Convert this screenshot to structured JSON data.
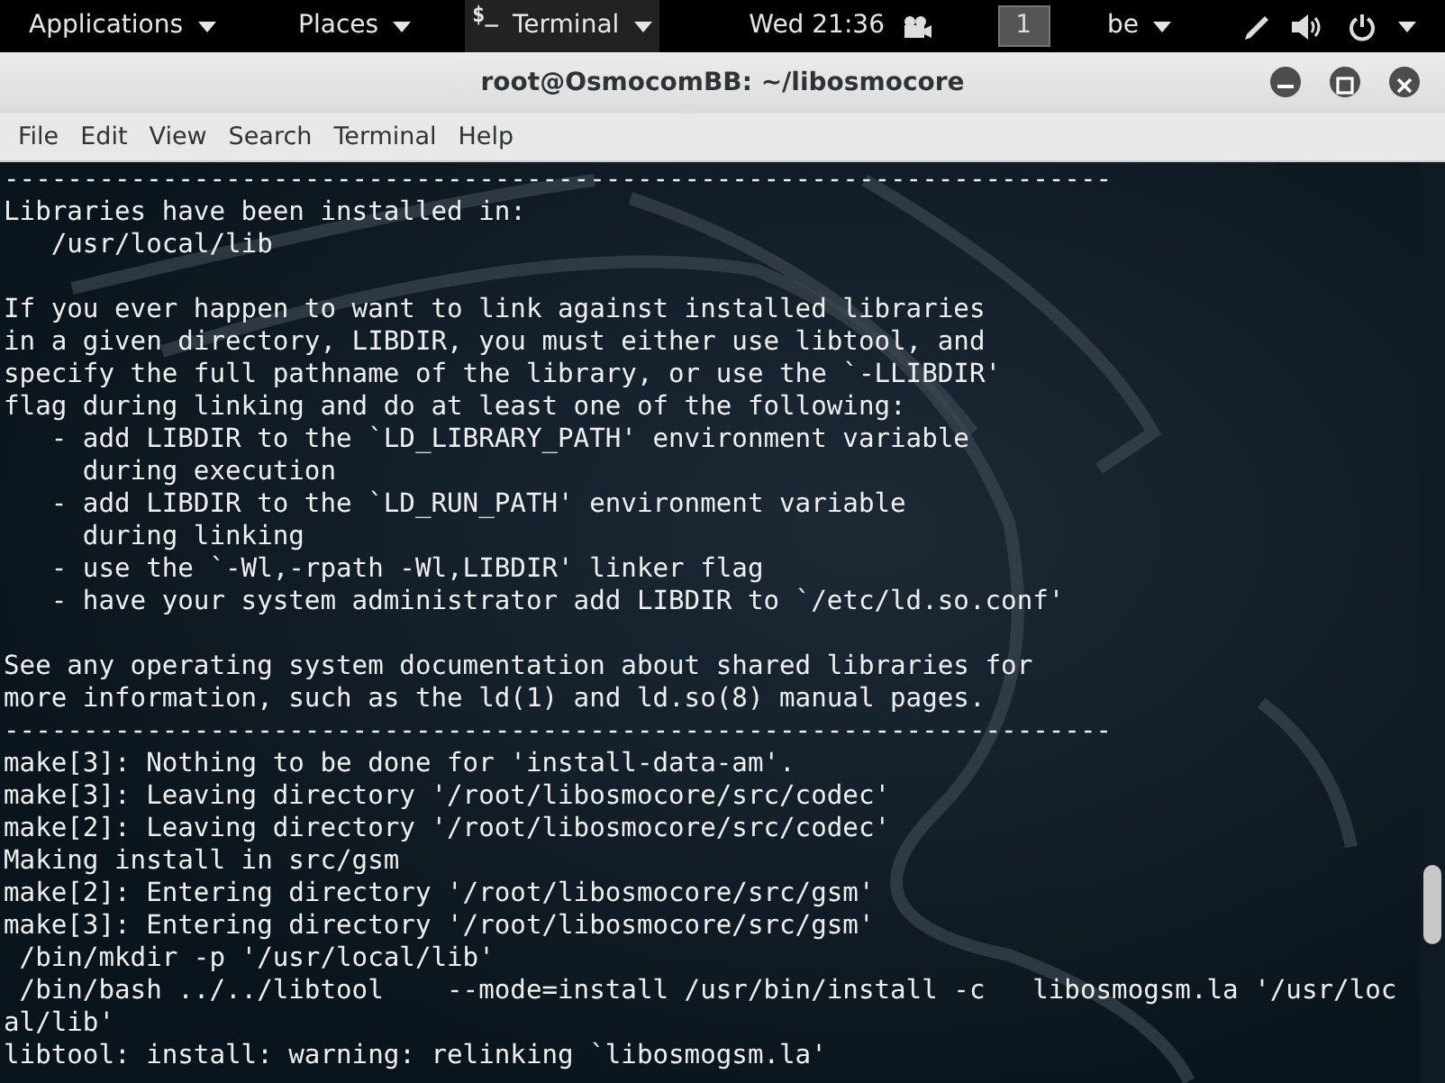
{
  "top_bar": {
    "menus": [
      {
        "label": "Applications"
      },
      {
        "label": "Places"
      },
      {
        "label": "Terminal",
        "kind": "app",
        "icon": "$_"
      }
    ],
    "clock": "Wed 21:36",
    "workspace": "1",
    "keyboard_layout": "be"
  },
  "window": {
    "title": "root@OsmocomBB: ~/libosmocore"
  },
  "menu_bar": [
    "File",
    "Edit",
    "View",
    "Search",
    "Terminal",
    "Help"
  ],
  "terminal": {
    "lines": [
      {
        "text": "----------------------------------------------------------------------"
      },
      {
        "text": "Libraries have been installed in:"
      },
      {
        "text": "   /usr/local/lib"
      },
      {
        "text": "If you ever happen to want to link against installed libraries",
        "blank_before": true
      },
      {
        "text": "in a given directory, LIBDIR, you must either use libtool, and"
      },
      {
        "text": "specify the full pathname of the library, or use the `-LLIBDIR'"
      },
      {
        "text": "flag during linking and do at least one of the following:"
      },
      {
        "text": "   - add LIBDIR to the `LD_LIBRARY_PATH' environment variable"
      },
      {
        "text": "     during execution"
      },
      {
        "text": "   - add LIBDIR to the `LD_RUN_PATH' environment variable"
      },
      {
        "text": "     during linking"
      },
      {
        "text": "   - use the `-Wl,-rpath -Wl,LIBDIR' linker flag"
      },
      {
        "text": "   - have your system administrator add LIBDIR to `/etc/ld.so.conf'"
      },
      {
        "text": "See any operating system documentation about shared libraries for",
        "blank_before": true
      },
      {
        "text": "more information, such as the ld(1) and ld.so(8) manual pages."
      },
      {
        "text": "----------------------------------------------------------------------"
      },
      {
        "text": "make[3]: Nothing to be done for 'install-data-am'."
      },
      {
        "text": "make[3]: Leaving directory '/root/libosmocore/src/codec'"
      },
      {
        "text": "make[2]: Leaving directory '/root/libosmocore/src/codec'"
      },
      {
        "text": "Making install in src/gsm"
      },
      {
        "text": "make[2]: Entering directory '/root/libosmocore/src/gsm'"
      },
      {
        "text": "make[3]: Entering directory '/root/libosmocore/src/gsm'"
      },
      {
        "text": " /bin/mkdir -p '/usr/local/lib'"
      },
      {
        "text": " /bin/bash ../../libtool    --mode=install /usr/bin/install -c   libosmogsm.la '/usr/loc"
      },
      {
        "text": "al/lib'"
      },
      {
        "text": "libtool: install: warning: relinking `libosmogsm.la'"
      }
    ]
  }
}
